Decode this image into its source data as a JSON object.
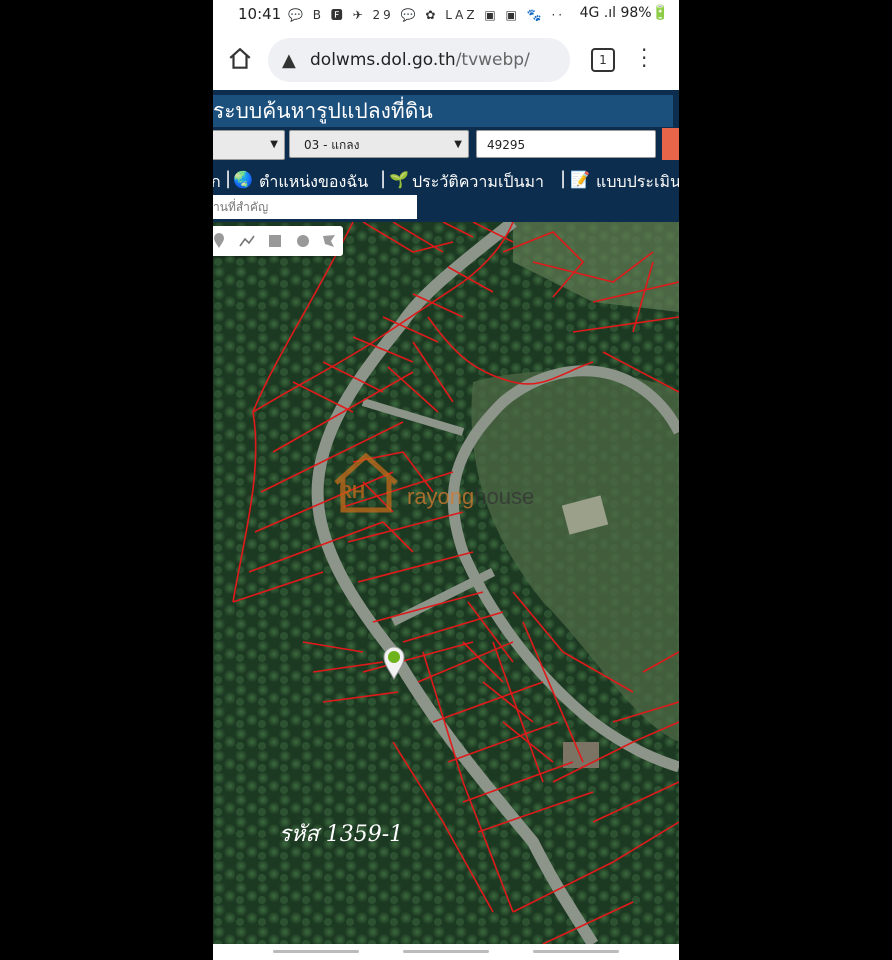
{
  "status_bar": {
    "time": "10:41",
    "notification_icons": "💬 B 🅵 ✈ 29 💬 ✿ LAZ ▣ ▣ 🐾 ··",
    "right": "4G .ıl 98%🔋"
  },
  "browser": {
    "url_host": "dolwms.dol.go.th",
    "url_path": "/tvwebp/",
    "tab_count": "1"
  },
  "app": {
    "title": "ระบบค้นหารูปแปลงที่ดิน",
    "province_select": "",
    "district_select": "03 - แกลง",
    "parcel_number": "49295",
    "nav": {
      "item_partial": "ก",
      "my_location": "ตำแหน่งของฉัน",
      "history": "ประวัติความเป็นมา",
      "assessment": "แบบประเมิน"
    },
    "place_search_placeholder": "านที่สำคัญ"
  },
  "map": {
    "parcel_code_label": "รหัส 1359-1",
    "watermark": {
      "logo": "RH",
      "brand_a": "rayong",
      "brand_b": "house"
    },
    "tools": [
      "marker-icon",
      "polyline-icon",
      "rectangle-icon",
      "circle-icon",
      "polygon-icon"
    ],
    "colors": {
      "parcel_line": "#e01a1a",
      "road": "#8d9489"
    }
  }
}
